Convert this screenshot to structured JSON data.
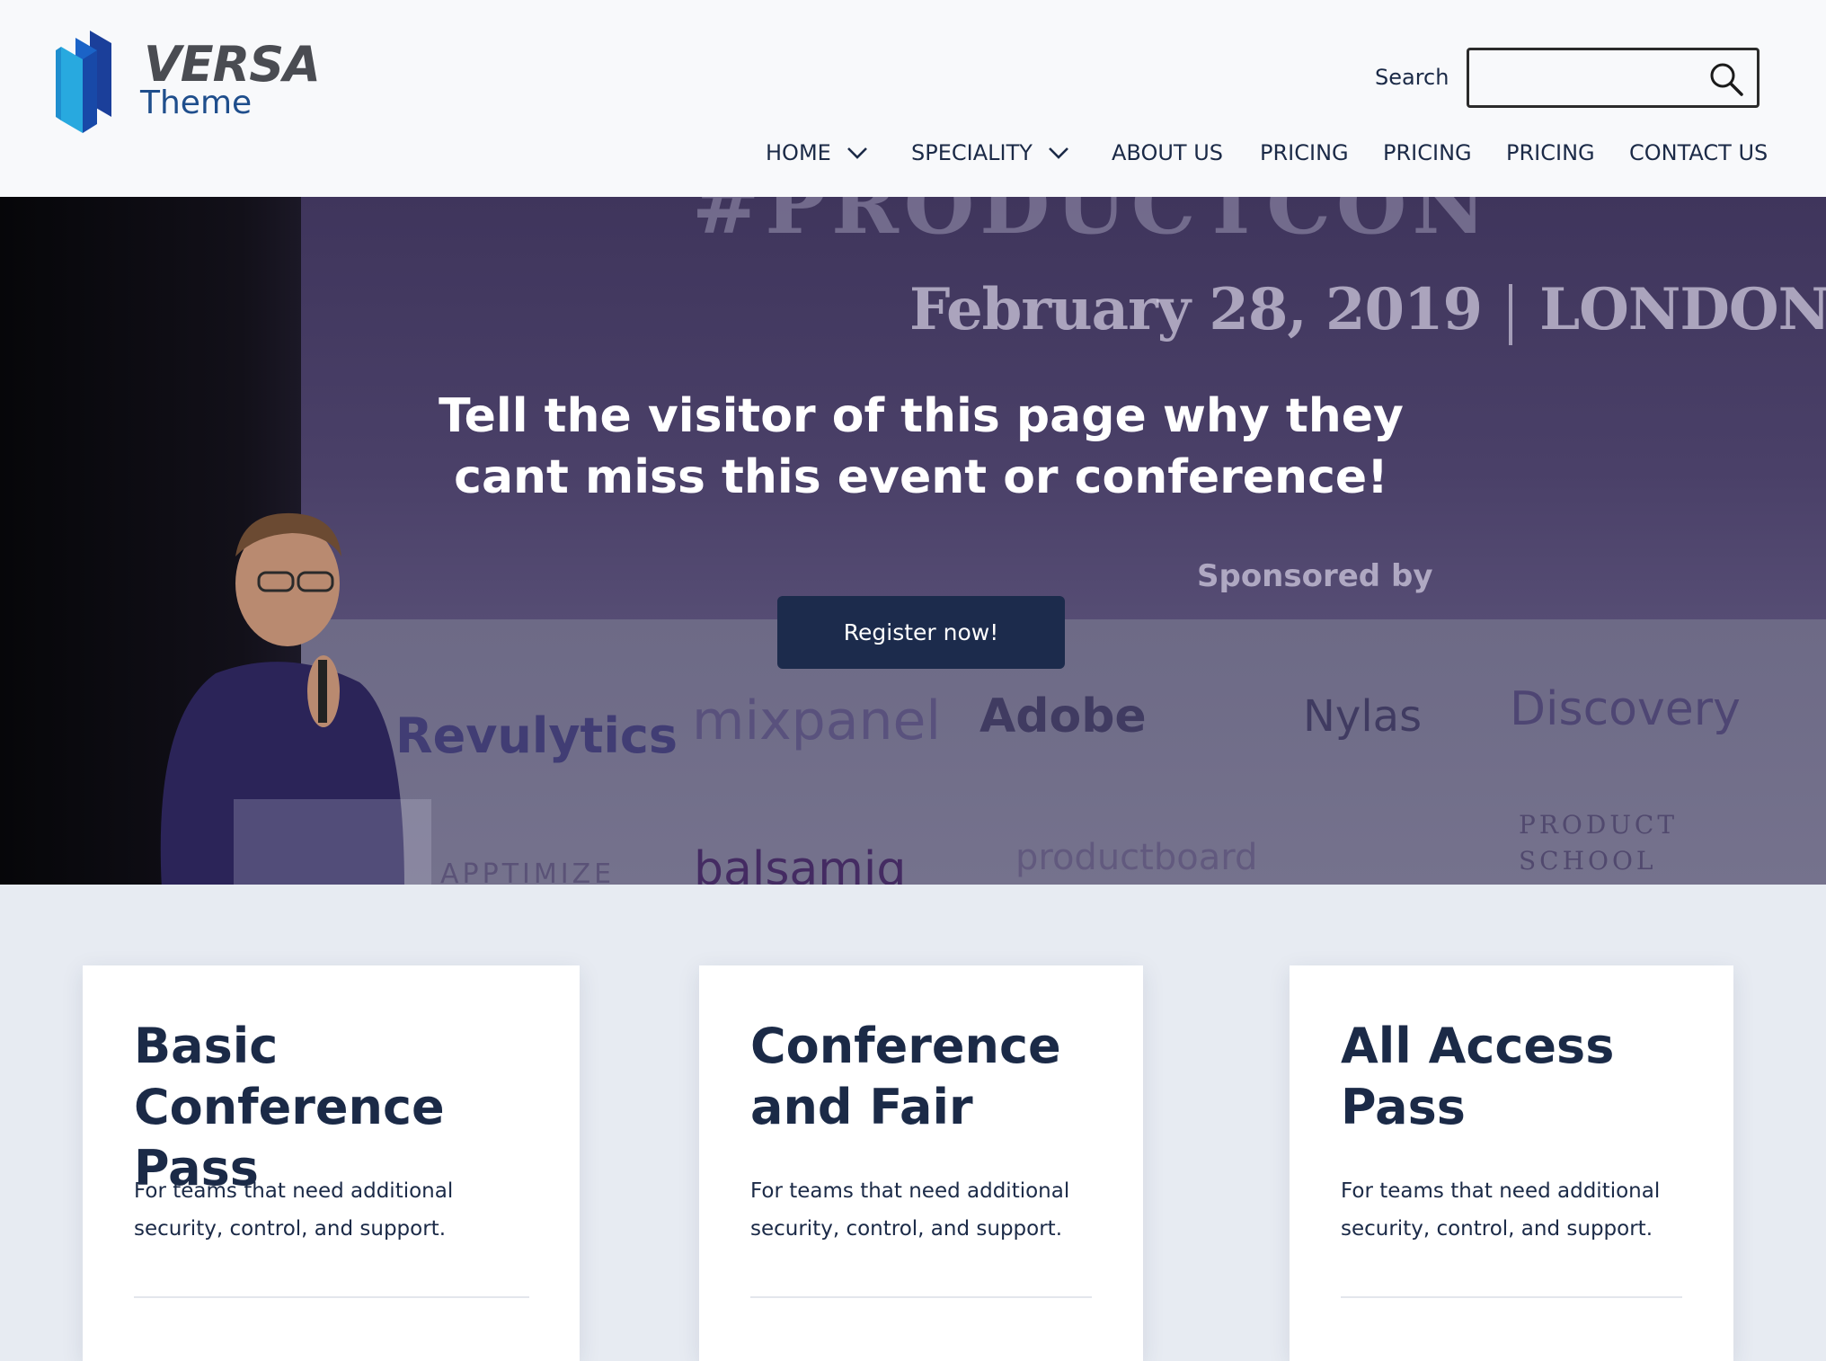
{
  "brand": {
    "name_top": "VERSA",
    "name_bottom": "Theme"
  },
  "search": {
    "label": "Search",
    "value": "",
    "placeholder": ""
  },
  "nav": {
    "items": [
      {
        "label": "HOME",
        "dropdown": true
      },
      {
        "label": "SPECIALITY",
        "dropdown": true
      },
      {
        "label": "ABOUT US",
        "dropdown": false
      },
      {
        "label": "PRICING",
        "dropdown": false
      },
      {
        "label": "PRICING",
        "dropdown": false
      },
      {
        "label": "PRICING",
        "dropdown": false
      },
      {
        "label": "CONTACT US",
        "dropdown": false
      }
    ]
  },
  "hero": {
    "photo_text": {
      "big": "#PRODUCTCON",
      "date": "February 28, 2019",
      "city": "LONDON",
      "sponsored": "Sponsored by",
      "sponsors": [
        "Revulytics",
        "mixpanel",
        "Adobe",
        "Nylas",
        "Discovery",
        "balsamiq",
        "productboard",
        "APPTIMIZE",
        "PRODUCT",
        "SCHOOL"
      ]
    },
    "title": "Tell the visitor of this page why they cant miss this event or conference!",
    "cta": "Register now!"
  },
  "cards": [
    {
      "title": "Basic\nConference Pass",
      "description": "For teams that need additional security, control, and support."
    },
    {
      "title": "Conference\nand Fair",
      "description": "For teams that need additional security, control, and support."
    },
    {
      "title": "All Access\nPass",
      "description": "For teams that need additional security, control, and support."
    }
  ],
  "colors": {
    "header_bg": "#f8f9fb",
    "page_bg": "#e7ebf2",
    "primary_navy": "#1c2b4c",
    "text": "#1b2a47",
    "logo_blue": "#1f4e8c"
  }
}
